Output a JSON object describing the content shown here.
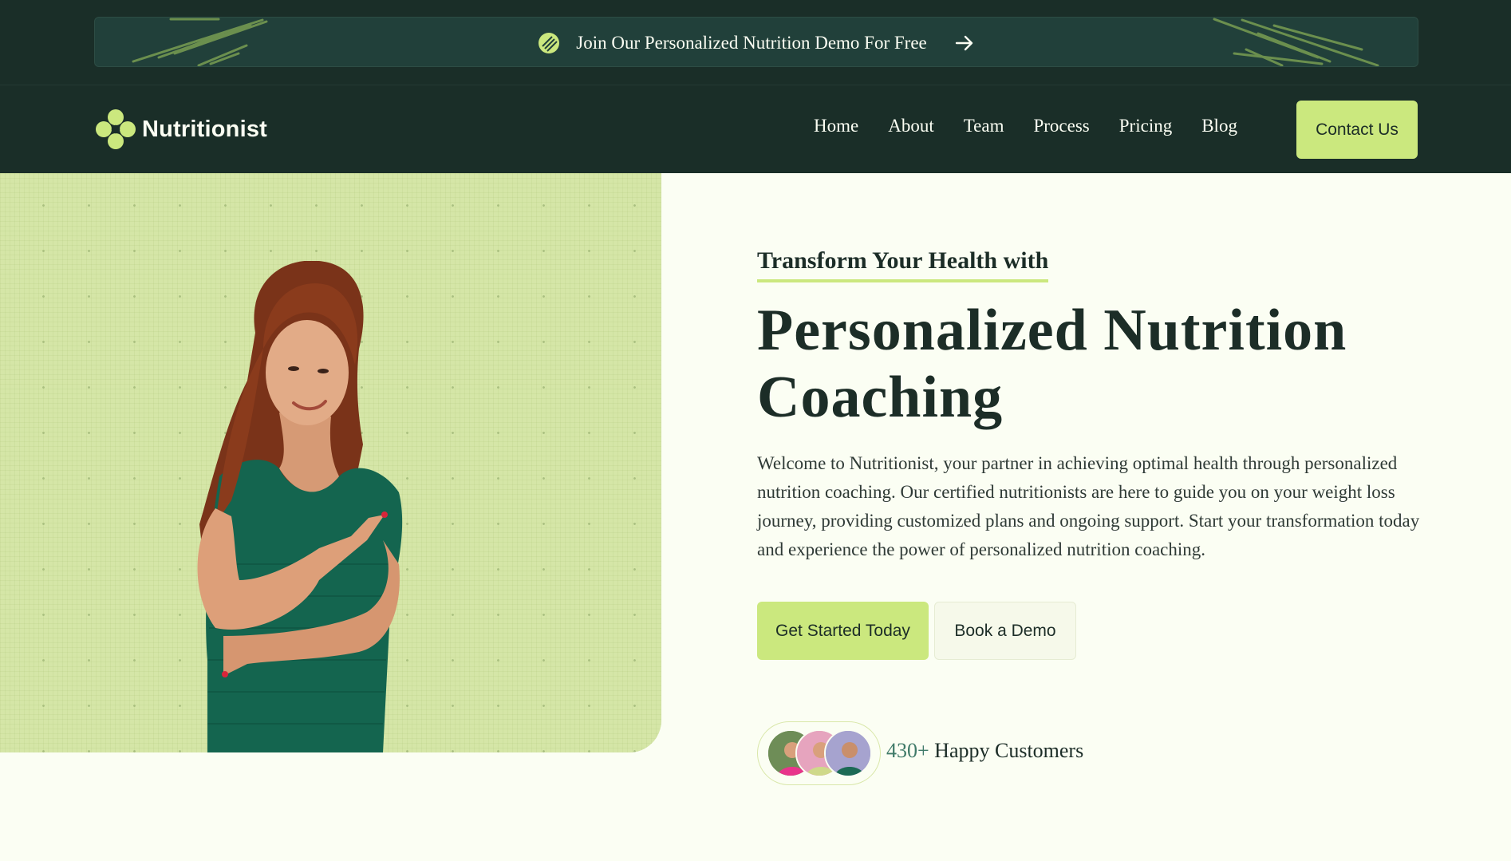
{
  "banner": {
    "text": "Join Our Personalized Nutrition Demo For Free",
    "icon": "leaf-badge-icon",
    "arrow_icon": "arrow-right-icon"
  },
  "nav": {
    "brand": "Nutritionist",
    "links": [
      "Home",
      "About",
      "Team",
      "Process",
      "Pricing",
      "Blog"
    ],
    "cta": "Contact Us"
  },
  "hero": {
    "eyebrow": "Transform Your Health with",
    "headline_line1": "Personalized Nutrition",
    "headline_line2": "Coaching",
    "intro": "Welcome to Nutritionist, your partner in achieving optimal health through personalized nutrition coaching. Our certified nutritionists are here to guide you on your weight loss journey, providing customized plans and ongoing support. Start your transformation today and experience the power of personalized nutrition coaching.",
    "primary_button": "Get Started Today",
    "secondary_button": "Book a Demo",
    "customers_count": "430+",
    "customers_label": "Happy Customers"
  },
  "colors": {
    "dark_green": "#1a2e28",
    "lime": "#cbe87e",
    "hero_bg": "#d5e6a7",
    "page_bg": "#fbfef3"
  }
}
